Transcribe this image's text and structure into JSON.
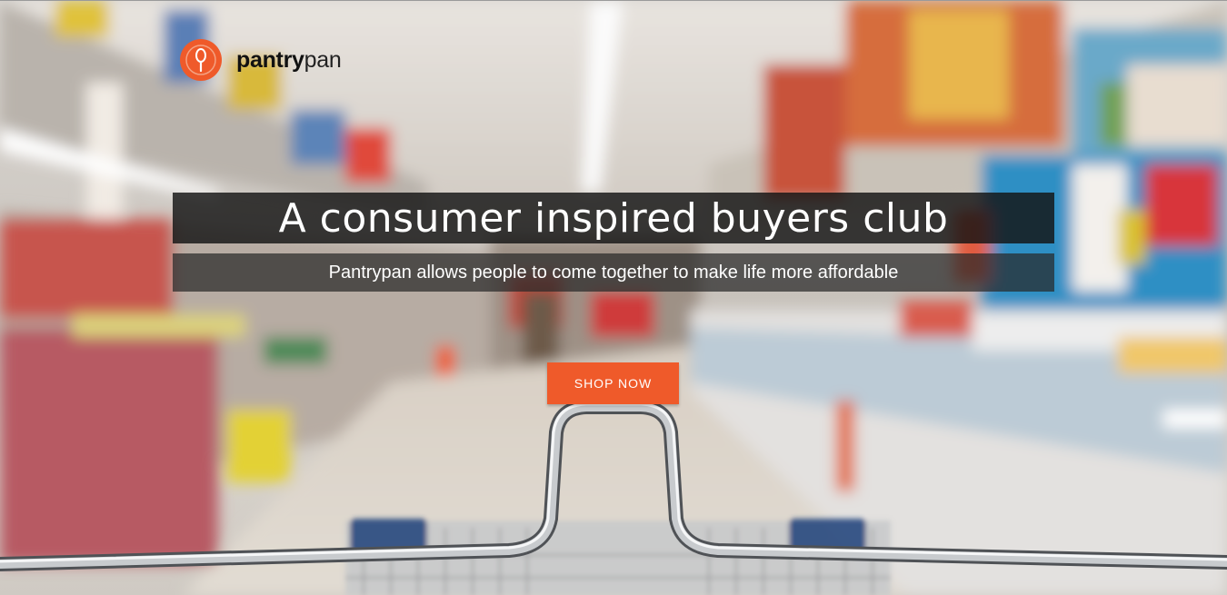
{
  "brand": {
    "name_bold": "pantry",
    "name_light": "pan",
    "accent_color": "#ef5a2a"
  },
  "hero": {
    "headline": "A consumer inspired buyers club",
    "subheadline": "Pantrypan allows people to come together to make life more affordable",
    "cta_label": "SHOP NOW",
    "background_image": "blurred supermarket aisle with shopping cart handle"
  },
  "icons": {
    "logo": "spoon-icon"
  }
}
